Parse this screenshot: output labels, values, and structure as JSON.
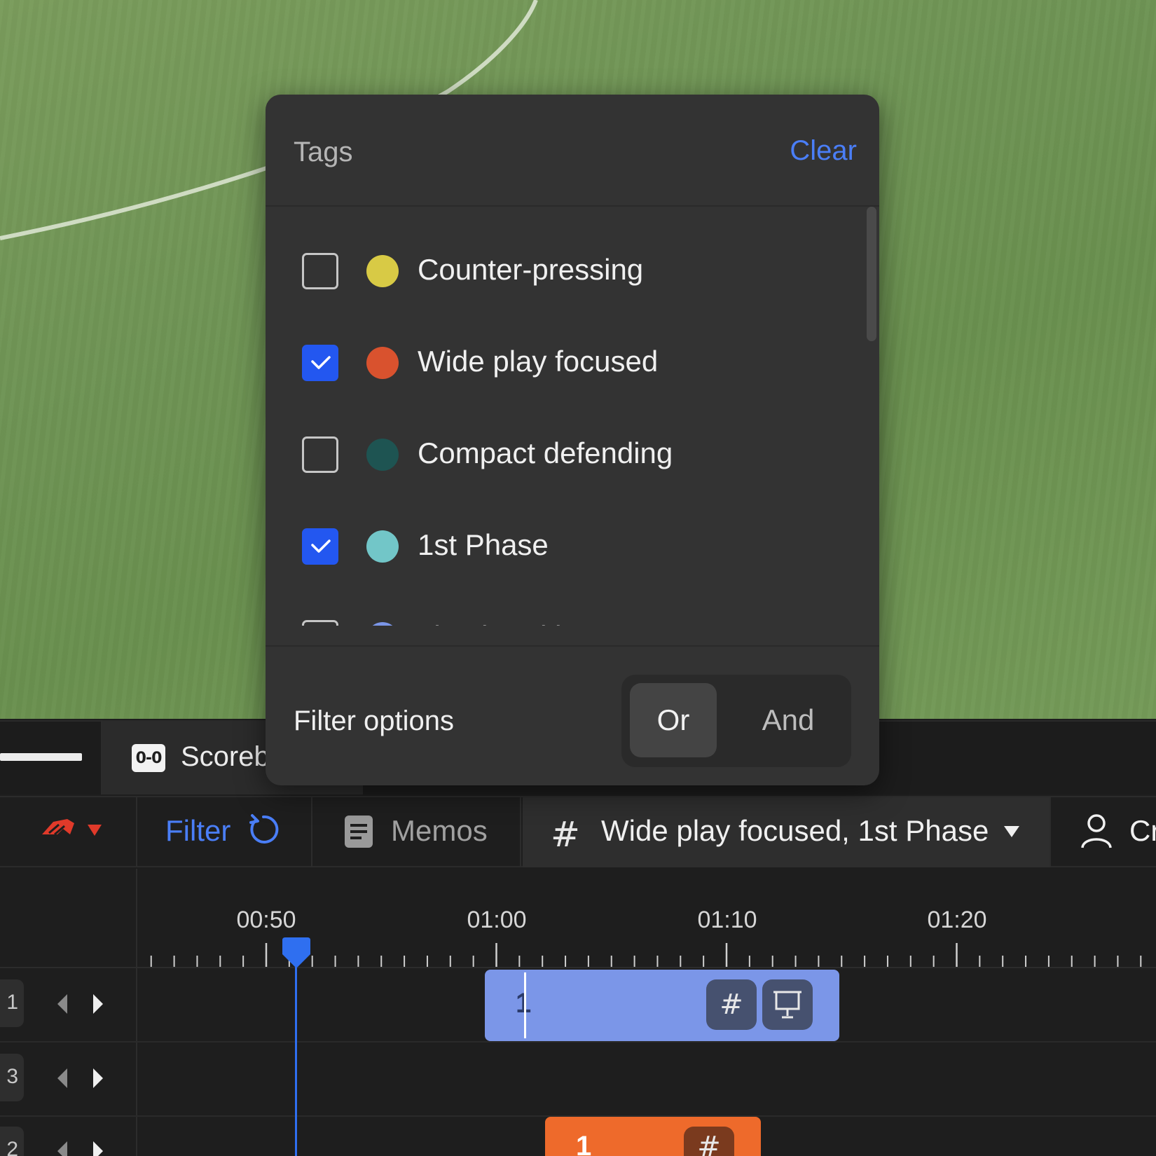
{
  "popup": {
    "title": "Tags",
    "clear_label": "Clear",
    "tags": [
      {
        "label": "Counter-pressing",
        "checked": false,
        "color": "#d8ca45"
      },
      {
        "label": "Wide play focused",
        "checked": true,
        "color": "#d9522e"
      },
      {
        "label": "Compact defending",
        "checked": false,
        "color": "#1e5452"
      },
      {
        "label": "1st Phase",
        "checked": true,
        "color": "#72c6c8"
      },
      {
        "label": "Line breaking movement",
        "checked": false,
        "color": "#7b96e8"
      }
    ],
    "filter_label": "Filter options",
    "filter_modes": {
      "or": "Or",
      "and": "And",
      "selected": "Or"
    }
  },
  "top_bar": {
    "score_icon": "0-0",
    "score_label": "Scoreboard"
  },
  "toolbar": {
    "filter_label": "Filter",
    "memos_label": "Memos",
    "tag_selector_label": "Wide play focused, 1st Phase",
    "next_label": "Cr",
    "icons": [
      "team-logo-icon",
      "caret-down-icon",
      "reset-icon",
      "memo-icon",
      "hash-icon",
      "person-icon"
    ],
    "accent_color": "#4a7ef7"
  },
  "timeline": {
    "tick_labels": [
      "00:50",
      "01:00",
      "01:10",
      "01:20"
    ],
    "tracks": [
      {
        "tab": "1"
      },
      {
        "tab": "3"
      },
      {
        "tab": "2"
      }
    ],
    "clips": [
      {
        "number": "1",
        "color": "#7b96e8"
      },
      {
        "number": "1",
        "color": "#ee6a2b"
      }
    ]
  }
}
